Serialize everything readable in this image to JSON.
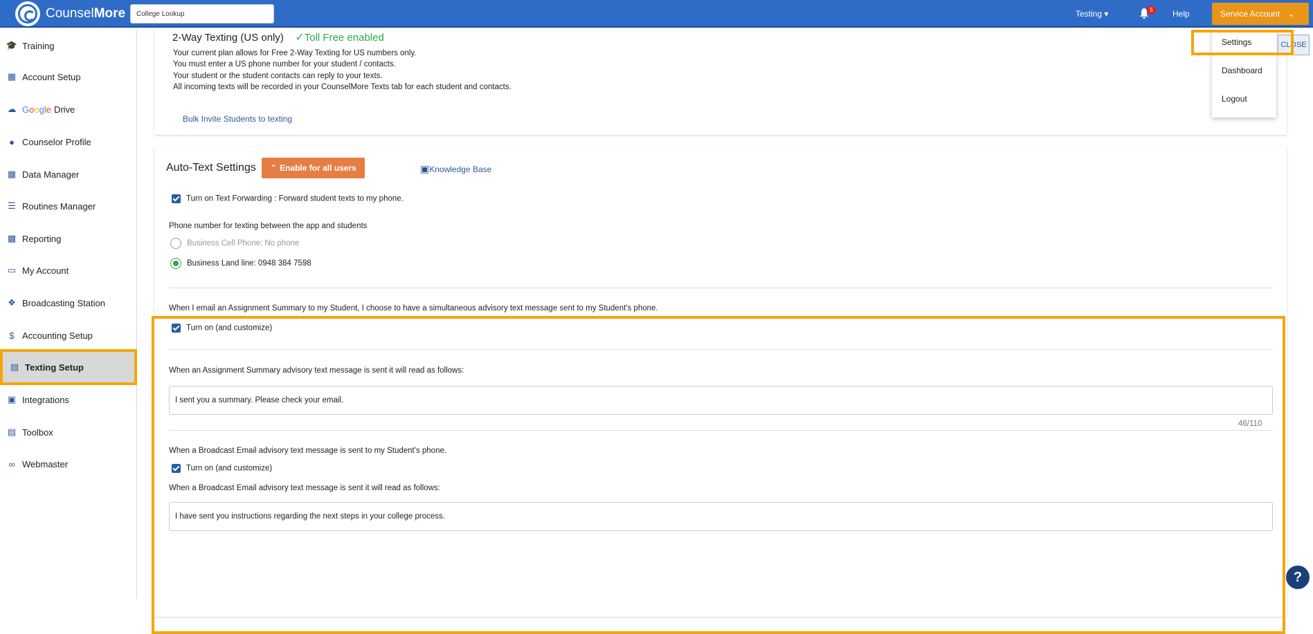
{
  "header": {
    "brand_light": "Counsel",
    "brand_bold": "More",
    "search_value": "College Lookup",
    "testing_label": "Testing",
    "notification_count": "5",
    "help_label": "Help",
    "account_label": "Service Account"
  },
  "account_menu": {
    "items": [
      {
        "label": "Settings"
      },
      {
        "label": "Dashboard"
      },
      {
        "label": "Logout"
      }
    ],
    "close_label": "CLOSE"
  },
  "sidebar": {
    "items": [
      {
        "label": "Training",
        "icon": "graduation-icon"
      },
      {
        "label": "Account Setup",
        "icon": "building-icon"
      },
      {
        "label": "Drive",
        "icon": "cloud-check-icon"
      },
      {
        "label": "Counselor Profile",
        "icon": "person-icon"
      },
      {
        "label": "Data Manager",
        "icon": "table-icon"
      },
      {
        "label": "Routines Manager",
        "icon": "list-icon"
      },
      {
        "label": "Reporting",
        "icon": "bar-chart-icon"
      },
      {
        "label": "My Account",
        "icon": "card-icon"
      },
      {
        "label": "Broadcasting Station",
        "icon": "antenna-icon"
      },
      {
        "label": "Accounting Setup",
        "icon": "dollar-icon"
      },
      {
        "label": "Texting Setup",
        "icon": "chat-icon"
      },
      {
        "label": "Integrations",
        "icon": "calendar-icon"
      },
      {
        "label": "Toolbox",
        "icon": "toolbox-icon"
      },
      {
        "label": "Webmaster",
        "icon": "link-icon"
      }
    ],
    "google_label": "Google"
  },
  "texting": {
    "title": "2-Way Texting (US only)",
    "toll_free": "Toll Free enabled",
    "lines": [
      "Your current plan allows for Free 2-Way Texting for US numbers only.",
      "You must enter a US phone number for your student / contacts.",
      "Your student or the student contacts can reply to your texts.",
      "All incoming texts will be recorded in your CounselMore Texts tab for each student and contacts."
    ],
    "bulk_invite": "Bulk Invite Students to texting"
  },
  "auto_text": {
    "title": "Auto-Text Settings",
    "enable_all": "Enable for all users",
    "knowledge_base": "Knowledge Base",
    "forwarding": "Turn on Text Forwarding : Forward student texts to my phone.",
    "phone_heading": "Phone number for texting between the app and students",
    "cell_phone": "Business Cell Phone: No phone",
    "land_line": "Business Land line: 0948 384 7598"
  },
  "assignment": {
    "intro": "When I email an Assignment Summary to my Student, I choose to have a simultaneous advisory text message sent to my Student's phone.",
    "turn_on": "Turn on (and customize)",
    "reads_as": "When an Assignment Summary advisory text message is sent it will read as follows:",
    "message": "I sent you a summary. Please check your email.",
    "counter": "46/110"
  },
  "broadcast": {
    "intro": "When a Broadcast Email advisory text message is sent to my Student's phone.",
    "turn_on": "Turn on (and customize)",
    "reads_as": "When a Broadcast Email advisory text message is sent it will read as follows:",
    "message": "I have sent you instructions regarding the next steps in your college process."
  },
  "help_button": "?",
  "colors": {
    "brand_blue": "#2f6cc7",
    "accent_orange": "#e8951a",
    "highlight": "#f5a60a",
    "success_green": "#2fa84a"
  }
}
